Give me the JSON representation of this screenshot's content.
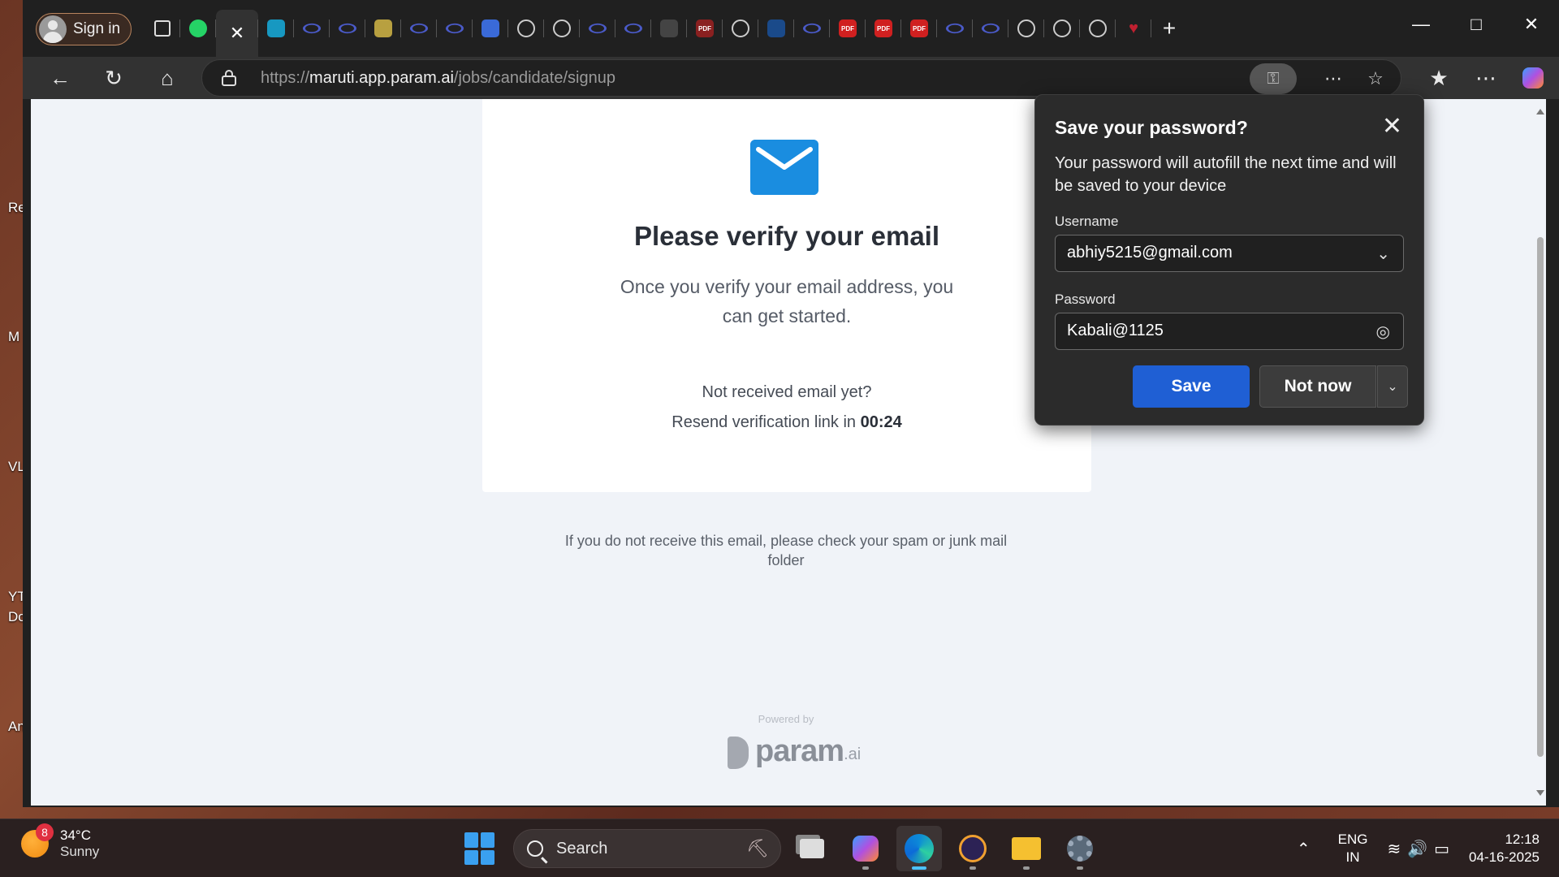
{
  "browser": {
    "sign_in_label": "Sign in",
    "tabs": [
      {
        "icon": "tab-actions-icon",
        "color": "#2a2a2a"
      },
      {
        "icon": "whatsapp-icon",
        "color": "#25d366"
      },
      {
        "icon": "close-tab-icon",
        "color": "#323232"
      },
      {
        "icon": "salesforce-icon",
        "color": "#1798c1"
      },
      {
        "icon": "param-tab-icon",
        "color": "#4a5ac8"
      },
      {
        "icon": "param-tab-icon",
        "color": "#4a5ac8"
      },
      {
        "icon": "coin-icon",
        "color": "#b8a040"
      },
      {
        "icon": "param-tab-icon",
        "color": "#4a5ac8"
      },
      {
        "icon": "param-tab-icon",
        "color": "#4a5ac8"
      },
      {
        "icon": "docs-icon",
        "color": "#3a6ad8"
      },
      {
        "icon": "openai-icon",
        "color": "#444"
      },
      {
        "icon": "openai-icon",
        "color": "#444"
      },
      {
        "icon": "param-tab-icon",
        "color": "#4a5ac8"
      },
      {
        "icon": "param-tab-icon",
        "color": "#4a5ac8"
      },
      {
        "icon": "calendar-icon",
        "color": "#444"
      },
      {
        "icon": "pdf-icon",
        "color": "#8a2020"
      },
      {
        "icon": "github-icon",
        "color": "#333"
      },
      {
        "icon": "search-tab-icon",
        "color": "#1a4a8a"
      },
      {
        "icon": "param-tab-icon",
        "color": "#4a5ac8"
      },
      {
        "icon": "pdf-icon",
        "color": "#d02020"
      },
      {
        "icon": "pdf-icon",
        "color": "#d02020"
      },
      {
        "icon": "pdf-icon",
        "color": "#d02020"
      },
      {
        "icon": "param-tab-icon",
        "color": "#4a5ac8"
      },
      {
        "icon": "param-tab-icon",
        "color": "#4a5ac8"
      },
      {
        "icon": "globe-icon",
        "color": "#444"
      },
      {
        "icon": "openai-icon",
        "color": "#444"
      },
      {
        "icon": "openai-icon",
        "color": "#444"
      },
      {
        "icon": "heart-icon",
        "color": "#c02030"
      }
    ],
    "url_prefix": "https://",
    "url_host": "maruti.app.param.ai",
    "url_path": "/jobs/candidate/signup"
  },
  "page": {
    "title": "Please verify your email",
    "subtitle": "Once you verify your email address, you can get started.",
    "not_received": "Not received email yet?",
    "resend_text": "Resend verification link in",
    "resend_timer": "00:24",
    "spam_note": "If you do not receive this email, please check your spam or junk mail folder",
    "powered_by": "Powered by",
    "brand_name": "param",
    "brand_suffix": ".ai",
    "accent_color": "#1a8de0"
  },
  "password_popup": {
    "title": "Save your password?",
    "description": "Your password will autofill the next time and will be saved to your device",
    "username_label": "Username",
    "username_value": "abhiy5215@gmail.com",
    "password_label": "Password",
    "password_value": "Kabali@1125",
    "save_label": "Save",
    "not_now_label": "Not now",
    "save_color": "#1f5fd4"
  },
  "desktop": {
    "labels": [
      "Re",
      "M",
      "VL",
      "YT",
      "Do",
      "An"
    ]
  },
  "taskbar": {
    "weather_badge": "8",
    "temperature": "34°C",
    "condition": "Sunny",
    "search_label": "Search",
    "lang_top": "ENG",
    "lang_bottom": "IN",
    "time": "12:18",
    "date": "04-16-2025"
  }
}
